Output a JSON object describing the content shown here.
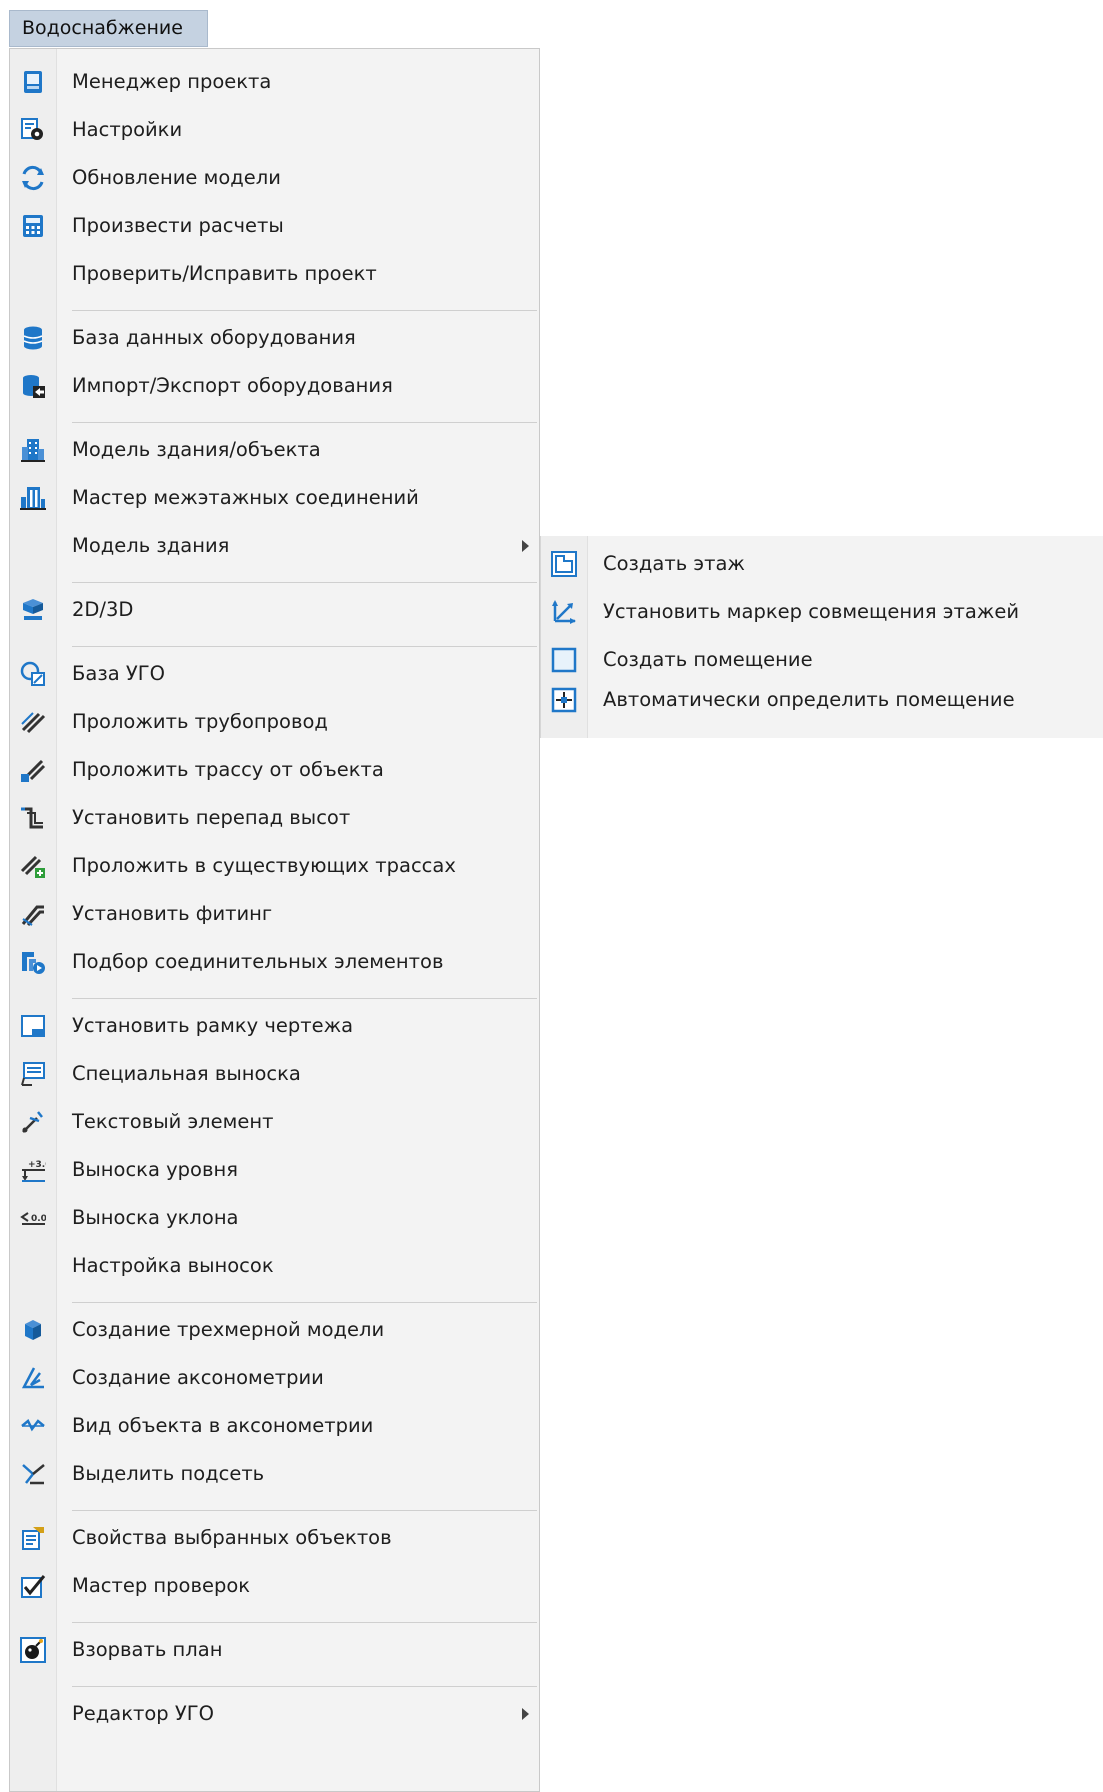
{
  "menubar": {
    "title": "Водоснабжение"
  },
  "main_menu": {
    "items": [
      {
        "label": "Менеджер проекта",
        "icon": "project-manager-icon"
      },
      {
        "label": "Настройки",
        "icon": "settings-icon"
      },
      {
        "label": "Обновление модели",
        "icon": "model-refresh-icon"
      },
      {
        "label": "Произвести расчеты",
        "icon": "calculator-icon"
      },
      {
        "label": "Проверить/Исправить проект",
        "icon": ""
      },
      {
        "label": "База данных оборудования",
        "icon": "database-icon"
      },
      {
        "label": "Импорт/Экспорт оборудования",
        "icon": "database-import-export-icon"
      },
      {
        "label": "Модель здания/объекта",
        "icon": "building-model-icon"
      },
      {
        "label": "Мастер межэтажных соединений",
        "icon": "interfloor-connections-icon"
      },
      {
        "label": "Модель здания",
        "icon": "",
        "has_submenu": true
      },
      {
        "label": "2D/3D",
        "icon": "2d-3d-icon"
      },
      {
        "label": "База УГО",
        "icon": "symbol-library-icon"
      },
      {
        "label": "Проложить трубопровод",
        "icon": "pipeline-icon"
      },
      {
        "label": "Проложить трассу от объекта",
        "icon": "route-from-object-icon"
      },
      {
        "label": "Установить перепад высот",
        "icon": "height-drop-icon"
      },
      {
        "label": "Проложить в существующих трассах",
        "icon": "route-existing-icon"
      },
      {
        "label": "Установить фитинг",
        "icon": "fitting-icon"
      },
      {
        "label": "Подбор соединительных элементов",
        "icon": "connectors-selection-icon"
      },
      {
        "label": "Установить рамку чертежа",
        "icon": "drawing-frame-icon"
      },
      {
        "label": "Специальная выноска",
        "icon": "special-callout-icon"
      },
      {
        "label": "Текстовый элемент",
        "icon": "text-element-icon"
      },
      {
        "label": "Выноска уровня",
        "icon": "level-callout-icon"
      },
      {
        "label": "Выноска уклона",
        "icon": "slope-callout-icon"
      },
      {
        "label": "Настройка выносок",
        "icon": ""
      },
      {
        "label": "Создание трехмерной модели",
        "icon": "3d-model-icon"
      },
      {
        "label": "Создание аксонометрии",
        "icon": "axonometry-icon"
      },
      {
        "label": "Вид объекта в аксонометрии",
        "icon": "axonometry-view-icon"
      },
      {
        "label": "Выделить подсеть",
        "icon": "subnet-select-icon"
      },
      {
        "label": "Свойства выбранных объектов",
        "icon": "object-properties-icon"
      },
      {
        "label": "Мастер проверок",
        "icon": "checkbox-icon"
      },
      {
        "label": "Взорвать план",
        "icon": "bomb-icon"
      },
      {
        "label": "Редактор УГО",
        "icon": "",
        "has_submenu": true
      }
    ]
  },
  "submenu": {
    "parent": "Модель здания",
    "items": [
      {
        "label": "Создать этаж",
        "icon": "create-floor-icon"
      },
      {
        "label": "Установить маркер совмещения этажей",
        "icon": "floor-align-marker-icon"
      },
      {
        "label": "Создать помещение",
        "icon": "create-room-icon"
      },
      {
        "label": "Автоматически определить помещение",
        "icon": "auto-detect-room-icon"
      }
    ]
  }
}
